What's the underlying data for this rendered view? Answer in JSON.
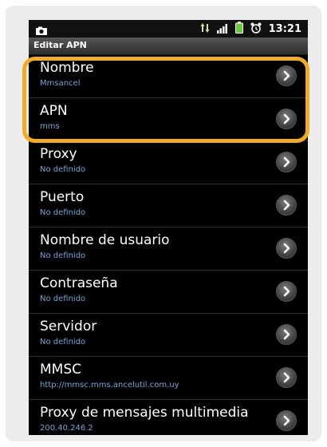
{
  "status_bar": {
    "time": "13:21",
    "icons": [
      "camera-icon",
      "data-arrows-icon",
      "signal-icon",
      "battery-icon",
      "alarm-icon"
    ]
  },
  "title_bar": {
    "title": "Editar APN"
  },
  "rows": [
    {
      "title": "Nombre",
      "value": "Mmsancel",
      "highlighted": true
    },
    {
      "title": "APN",
      "value": "mms",
      "highlighted": true
    },
    {
      "title": "Proxy",
      "value": "No definido"
    },
    {
      "title": "Puerto",
      "value": "No definido"
    },
    {
      "title": "Nombre de usuario",
      "value": "No definido"
    },
    {
      "title": "Contraseña",
      "value": "No definido"
    },
    {
      "title": "Servidor",
      "value": "No definido"
    },
    {
      "title": "MMSC",
      "value": "http://mmsc.mms.ancelutil.com.uy"
    },
    {
      "title": "Proxy de mensajes multimedia",
      "value": "200.40.246.2"
    }
  ],
  "colors": {
    "highlight": "#f2ac1d",
    "subtitle": "#6fa8d8",
    "background": "#000000"
  }
}
